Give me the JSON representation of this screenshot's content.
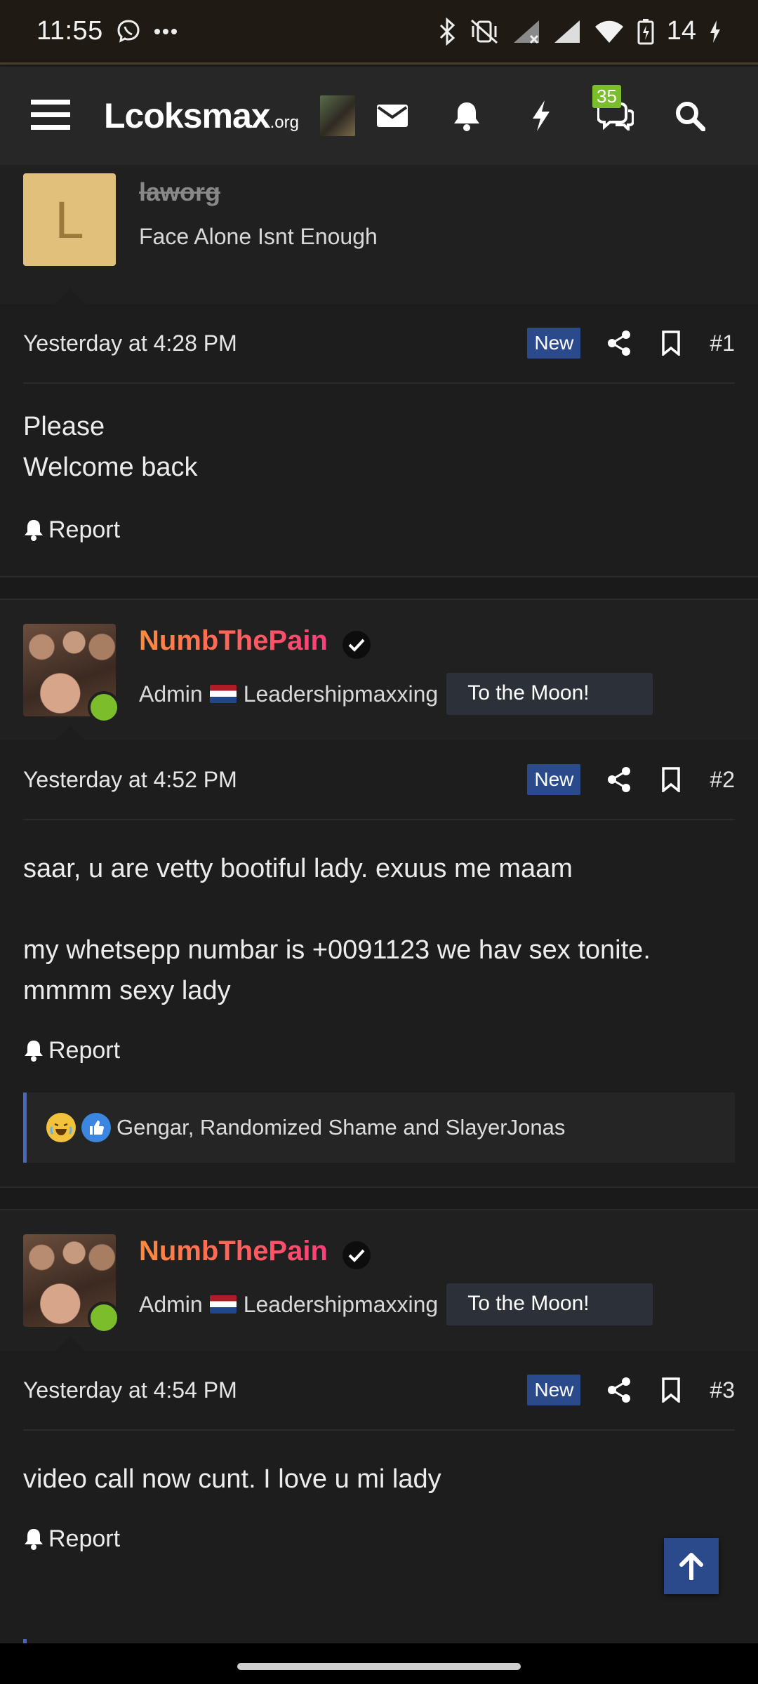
{
  "status_bar": {
    "time": "11:55",
    "battery": "14"
  },
  "nav": {
    "logo_main": "Lcoksmax",
    "logo_suffix": ".org",
    "chat_badge": "35"
  },
  "posts": [
    {
      "username": "laworg",
      "avatar_letter": "L",
      "user_title": "Face Alone Isnt Enough",
      "date": "Yesterday at 4:28 PM",
      "new_label": "New",
      "number": "#1",
      "body": [
        "Please",
        "Welcome back"
      ],
      "report_label": "Report"
    },
    {
      "username": "NumbThePain",
      "user_role": "Admin",
      "user_title": "Leadershipmaxxing",
      "banner": "To the Moon!",
      "date": "Yesterday at 4:52 PM",
      "new_label": "New",
      "number": "#2",
      "body": [
        "saar, u are vetty bootiful lady. exuus me maam",
        "my whetsepp numbar is +0091123 we hav sex tonite. mmmm sexy lady"
      ],
      "report_label": "Report",
      "reactions": "Gengar, Randomized Shame and SlayerJonas"
    },
    {
      "username": "NumbThePain",
      "user_role": "Admin",
      "user_title": "Leadershipmaxxing",
      "banner": "To the Moon!",
      "date": "Yesterday at 4:54 PM",
      "new_label": "New",
      "number": "#3",
      "body": [
        "video call now cunt. I love u mi lady"
      ],
      "report_label": "Report"
    }
  ]
}
